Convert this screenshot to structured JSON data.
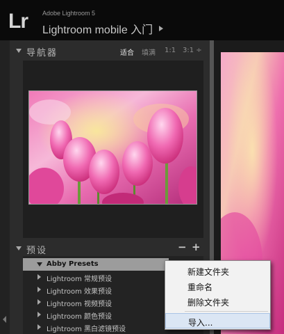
{
  "header": {
    "app_small": "Adobe Lightroom 5",
    "logo": "Lr",
    "title": "Lightroom mobile 入门"
  },
  "navigator": {
    "title": "导航器",
    "options": [
      "适合",
      "填满",
      "1:1",
      "3:1 ÷"
    ],
    "active_option": "适合"
  },
  "presets": {
    "title": "预设",
    "minus": "−",
    "plus": "+",
    "items": [
      {
        "label": "Abby Presets",
        "expanded": true,
        "selected": true
      },
      {
        "label": "Lightroom 常规预设"
      },
      {
        "label": "Lightroom 效果预设"
      },
      {
        "label": "Lightroom 视频预设"
      },
      {
        "label": "Lightroom 颜色预设"
      },
      {
        "label": "Lightroom 黑白滤镜预设"
      }
    ]
  },
  "context_menu": {
    "items": [
      {
        "label": "新建文件夹"
      },
      {
        "label": "重命名"
      },
      {
        "label": "删除文件夹"
      },
      {
        "label": "导入...",
        "hovered": true
      }
    ]
  },
  "colors": {
    "panel_bg": "#2c2c2c",
    "menu_bg": "#f2f2f2",
    "menu_hover": "#dbe6f4",
    "photo_pink": "#e84ea0"
  }
}
